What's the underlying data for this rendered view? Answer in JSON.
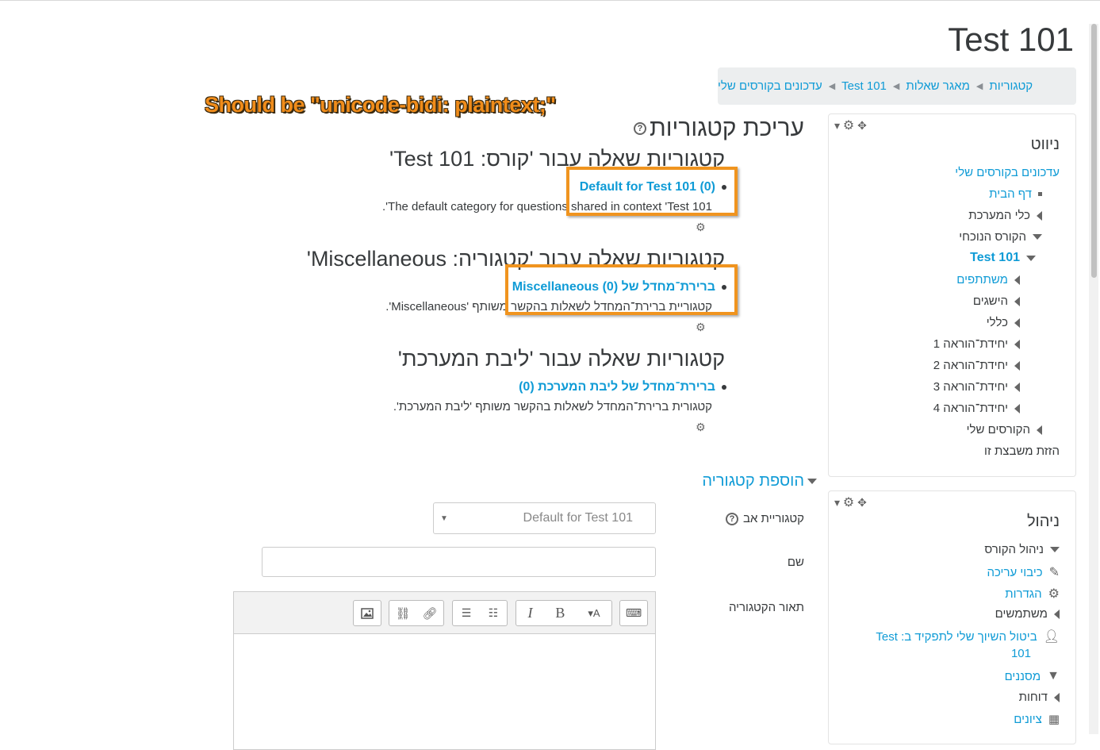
{
  "page": {
    "title": "Test 101",
    "breadcrumb": [
      "עדכונים בקורסים שלי",
      "Test 101",
      "מאגר שאלות",
      "קטגוריות"
    ],
    "annotation": "Should be  \"unicode-bidi: plaintext;\""
  },
  "main": {
    "heading": "עריכת קטגוריות",
    "sections": [
      {
        "heading": "קטגוריות שאלה עבור 'קורס: Test 101'",
        "item_link": "Default for Test 101 (0)",
        "item_desc": "The default category for questions shared in context 'Test 101'."
      },
      {
        "heading": "קטגוריות שאלה עבור 'קטגוריה: Miscellaneous'",
        "item_link": "ברירת־מחדל של Miscellaneous (0)",
        "item_desc": "קטגוריית ברירת־המחדל לשאלות בהקשר משותף 'Miscellaneous'."
      },
      {
        "heading": "קטגוריות שאלה עבור 'ליבת המערכת'",
        "item_link": "ברירת־מחדל של ליבת המערכת (0)",
        "item_desc": "קטגורית ברירת־המחדל לשאלות בהקשר משותף 'ליבת המערכת'."
      }
    ],
    "add_category": {
      "legend": "הוספת קטגוריה",
      "parent_label": "קטגוריית אב",
      "parent_value": "Default for Test 101",
      "name_label": "שם",
      "description_label": "תאור הקטגוריה"
    }
  },
  "navigation_block": {
    "title": "ניווט",
    "items": [
      {
        "label": "עדכונים בקורסים שלי",
        "kind": "link"
      },
      {
        "label": "דף הבית",
        "kind": "link"
      },
      {
        "label": "כלי המערכת",
        "kind": "text"
      },
      {
        "label": "הקורס הנוכחי",
        "kind": "text"
      },
      {
        "label": "Test 101",
        "kind": "link"
      },
      {
        "label": "משתתפים",
        "kind": "link"
      },
      {
        "label": "הישגים",
        "kind": "text"
      },
      {
        "label": "כללי",
        "kind": "text"
      },
      {
        "label": "יחידת־הוראה 1",
        "kind": "text"
      },
      {
        "label": "יחידת־הוראה 2",
        "kind": "text"
      },
      {
        "label": "יחידת־הוראה 3",
        "kind": "text"
      },
      {
        "label": "יחידת־הוראה 4",
        "kind": "text"
      },
      {
        "label": "הקורסים שלי",
        "kind": "text"
      },
      {
        "label": "הזזת משבצת זו",
        "kind": "text"
      }
    ]
  },
  "admin_block": {
    "title": "ניהול",
    "items": [
      {
        "label": "ניהול הקורס",
        "kind": "text"
      },
      {
        "label": "כיבוי עריכה",
        "kind": "link"
      },
      {
        "label": "הגדרות",
        "kind": "link"
      },
      {
        "label": "משתמשים",
        "kind": "text"
      },
      {
        "label": "ביטול השיוך שלי לתפקיד ב: Test",
        "kind": "link"
      },
      {
        "label": "101",
        "kind": "link"
      },
      {
        "label": "מסננים",
        "kind": "link"
      },
      {
        "label": "דוחות",
        "kind": "text"
      },
      {
        "label": "ציונים",
        "kind": "link"
      }
    ]
  },
  "icons": {
    "gear": "gear-icon",
    "move": "move-icon",
    "help": "help-icon"
  },
  "colors": {
    "link": "#0f9bd6",
    "highlight_box": "#f0941f",
    "annotation_text": "#f08c1a"
  }
}
